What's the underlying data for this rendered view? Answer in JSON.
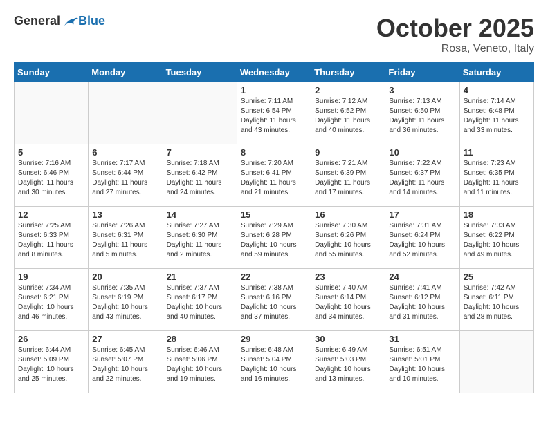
{
  "header": {
    "logo_general": "General",
    "logo_blue": "Blue",
    "month_title": "October 2025",
    "subtitle": "Rosa, Veneto, Italy"
  },
  "weekdays": [
    "Sunday",
    "Monday",
    "Tuesday",
    "Wednesday",
    "Thursday",
    "Friday",
    "Saturday"
  ],
  "weeks": [
    [
      {
        "day": "",
        "info": ""
      },
      {
        "day": "",
        "info": ""
      },
      {
        "day": "",
        "info": ""
      },
      {
        "day": "1",
        "info": "Sunrise: 7:11 AM\nSunset: 6:54 PM\nDaylight: 11 hours\nand 43 minutes."
      },
      {
        "day": "2",
        "info": "Sunrise: 7:12 AM\nSunset: 6:52 PM\nDaylight: 11 hours\nand 40 minutes."
      },
      {
        "day": "3",
        "info": "Sunrise: 7:13 AM\nSunset: 6:50 PM\nDaylight: 11 hours\nand 36 minutes."
      },
      {
        "day": "4",
        "info": "Sunrise: 7:14 AM\nSunset: 6:48 PM\nDaylight: 11 hours\nand 33 minutes."
      }
    ],
    [
      {
        "day": "5",
        "info": "Sunrise: 7:16 AM\nSunset: 6:46 PM\nDaylight: 11 hours\nand 30 minutes."
      },
      {
        "day": "6",
        "info": "Sunrise: 7:17 AM\nSunset: 6:44 PM\nDaylight: 11 hours\nand 27 minutes."
      },
      {
        "day": "7",
        "info": "Sunrise: 7:18 AM\nSunset: 6:42 PM\nDaylight: 11 hours\nand 24 minutes."
      },
      {
        "day": "8",
        "info": "Sunrise: 7:20 AM\nSunset: 6:41 PM\nDaylight: 11 hours\nand 21 minutes."
      },
      {
        "day": "9",
        "info": "Sunrise: 7:21 AM\nSunset: 6:39 PM\nDaylight: 11 hours\nand 17 minutes."
      },
      {
        "day": "10",
        "info": "Sunrise: 7:22 AM\nSunset: 6:37 PM\nDaylight: 11 hours\nand 14 minutes."
      },
      {
        "day": "11",
        "info": "Sunrise: 7:23 AM\nSunset: 6:35 PM\nDaylight: 11 hours\nand 11 minutes."
      }
    ],
    [
      {
        "day": "12",
        "info": "Sunrise: 7:25 AM\nSunset: 6:33 PM\nDaylight: 11 hours\nand 8 minutes."
      },
      {
        "day": "13",
        "info": "Sunrise: 7:26 AM\nSunset: 6:31 PM\nDaylight: 11 hours\nand 5 minutes."
      },
      {
        "day": "14",
        "info": "Sunrise: 7:27 AM\nSunset: 6:30 PM\nDaylight: 11 hours\nand 2 minutes."
      },
      {
        "day": "15",
        "info": "Sunrise: 7:29 AM\nSunset: 6:28 PM\nDaylight: 10 hours\nand 59 minutes."
      },
      {
        "day": "16",
        "info": "Sunrise: 7:30 AM\nSunset: 6:26 PM\nDaylight: 10 hours\nand 55 minutes."
      },
      {
        "day": "17",
        "info": "Sunrise: 7:31 AM\nSunset: 6:24 PM\nDaylight: 10 hours\nand 52 minutes."
      },
      {
        "day": "18",
        "info": "Sunrise: 7:33 AM\nSunset: 6:22 PM\nDaylight: 10 hours\nand 49 minutes."
      }
    ],
    [
      {
        "day": "19",
        "info": "Sunrise: 7:34 AM\nSunset: 6:21 PM\nDaylight: 10 hours\nand 46 minutes."
      },
      {
        "day": "20",
        "info": "Sunrise: 7:35 AM\nSunset: 6:19 PM\nDaylight: 10 hours\nand 43 minutes."
      },
      {
        "day": "21",
        "info": "Sunrise: 7:37 AM\nSunset: 6:17 PM\nDaylight: 10 hours\nand 40 minutes."
      },
      {
        "day": "22",
        "info": "Sunrise: 7:38 AM\nSunset: 6:16 PM\nDaylight: 10 hours\nand 37 minutes."
      },
      {
        "day": "23",
        "info": "Sunrise: 7:40 AM\nSunset: 6:14 PM\nDaylight: 10 hours\nand 34 minutes."
      },
      {
        "day": "24",
        "info": "Sunrise: 7:41 AM\nSunset: 6:12 PM\nDaylight: 10 hours\nand 31 minutes."
      },
      {
        "day": "25",
        "info": "Sunrise: 7:42 AM\nSunset: 6:11 PM\nDaylight: 10 hours\nand 28 minutes."
      }
    ],
    [
      {
        "day": "26",
        "info": "Sunrise: 6:44 AM\nSunset: 5:09 PM\nDaylight: 10 hours\nand 25 minutes."
      },
      {
        "day": "27",
        "info": "Sunrise: 6:45 AM\nSunset: 5:07 PM\nDaylight: 10 hours\nand 22 minutes."
      },
      {
        "day": "28",
        "info": "Sunrise: 6:46 AM\nSunset: 5:06 PM\nDaylight: 10 hours\nand 19 minutes."
      },
      {
        "day": "29",
        "info": "Sunrise: 6:48 AM\nSunset: 5:04 PM\nDaylight: 10 hours\nand 16 minutes."
      },
      {
        "day": "30",
        "info": "Sunrise: 6:49 AM\nSunset: 5:03 PM\nDaylight: 10 hours\nand 13 minutes."
      },
      {
        "day": "31",
        "info": "Sunrise: 6:51 AM\nSunset: 5:01 PM\nDaylight: 10 hours\nand 10 minutes."
      },
      {
        "day": "",
        "info": ""
      }
    ]
  ]
}
